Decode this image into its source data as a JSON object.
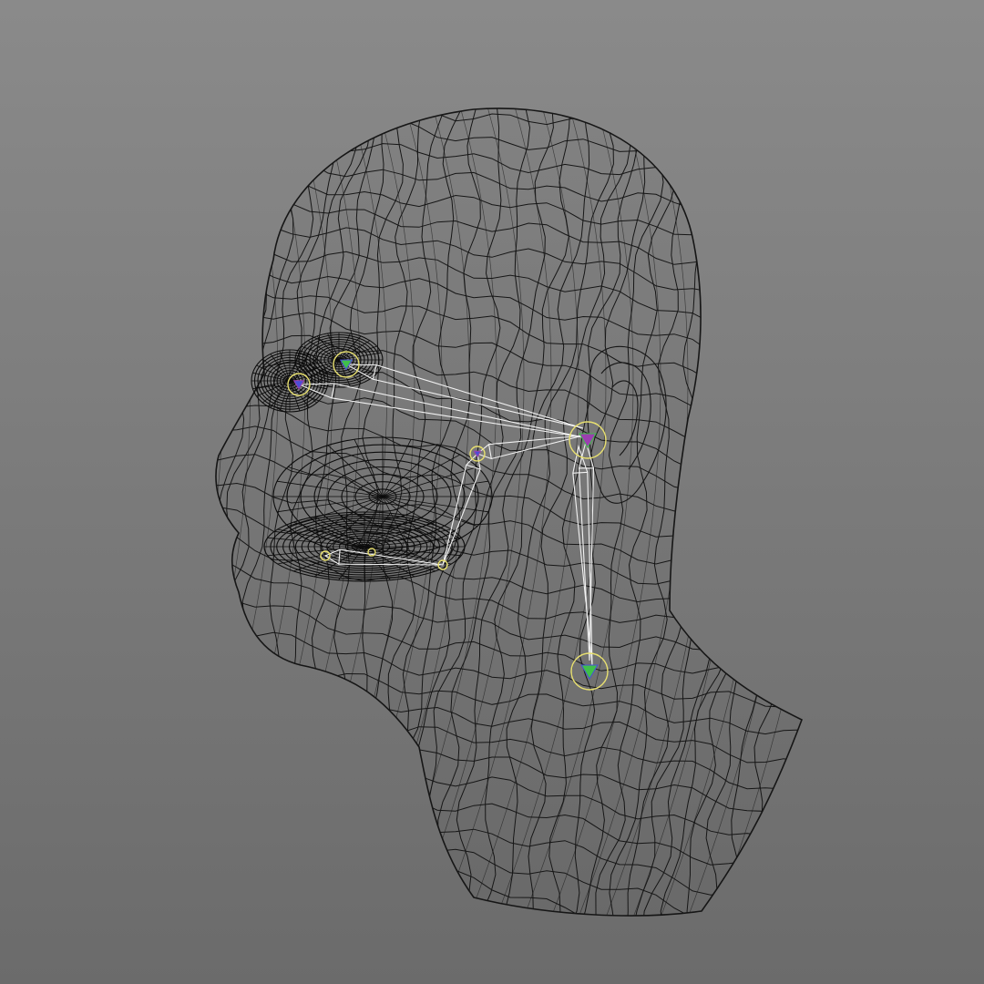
{
  "viewport": {
    "background_top": "#8a8a8a",
    "background_bottom": "#6b6b6b"
  },
  "mesh": {
    "wire_color": "#161616",
    "dense_wire_color": "#0c0c0c"
  },
  "rig": {
    "bone_color": "#f2f2f2",
    "joint_ring_color": "#e8e070",
    "joint_core_colors": [
      "#3fbf4a",
      "#4a4fd6",
      "#9b3fb0"
    ]
  }
}
